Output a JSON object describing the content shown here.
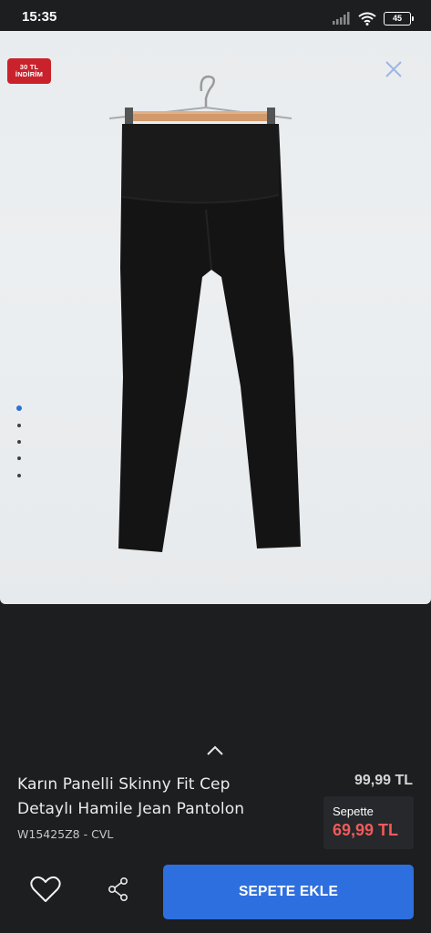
{
  "status_bar": {
    "time": "15:35",
    "battery": "45",
    "icons": [
      "signal-icon",
      "wifi-icon",
      "battery-icon"
    ]
  },
  "gallery": {
    "badge_line1": "30 TL",
    "badge_line2": "İNDİRİM",
    "image_count": 5,
    "active_index": 0,
    "close_icon": "close-icon"
  },
  "product": {
    "title_line1": "Karın Panelli Skinny Fit Cep",
    "title_line2": "Detaylı Hamile Jean Pantolon",
    "code": "W15425Z8 - CVL",
    "old_price": "99,99 TL",
    "cart_label": "Sepette",
    "cart_price": "69,99 TL"
  },
  "actions": {
    "favorite_icon": "heart-icon",
    "share_icon": "share-icon",
    "add_to_cart_label": "SEPETE EKLE"
  },
  "colors": {
    "background": "#1d1e20",
    "accent": "#2e6fe0",
    "badge": "#c9222c",
    "cart_price": "#f05a5a"
  }
}
